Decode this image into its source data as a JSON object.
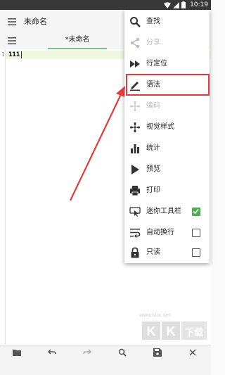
{
  "status_bar": {
    "time": "10:19"
  },
  "app_bar": {
    "title": "未命名"
  },
  "tabs": [
    {
      "label": "*未命名"
    }
  ],
  "editor": {
    "line_numbers": [
      "1"
    ],
    "lines": [
      "111"
    ]
  },
  "menu": {
    "items": [
      {
        "label": "查找",
        "icon": "search-icon",
        "enabled": true
      },
      {
        "label": "分享",
        "icon": "share-icon",
        "enabled": false
      },
      {
        "label": "行定位",
        "icon": "fast-forward-icon",
        "enabled": true
      },
      {
        "label": "语法",
        "icon": "pen-icon",
        "enabled": true
      },
      {
        "label": "编码",
        "icon": "fan-icon",
        "enabled": false
      },
      {
        "label": "视觉样式",
        "icon": "fan-icon",
        "enabled": true
      },
      {
        "label": "统计",
        "icon": "bar-chart-icon",
        "enabled": true
      },
      {
        "label": "预览",
        "icon": "play-icon",
        "enabled": true
      },
      {
        "label": "打印",
        "icon": "printer-icon",
        "enabled": true
      },
      {
        "label": "迷你工具栏",
        "icon": "touch-icon",
        "enabled": true,
        "checked": true
      },
      {
        "label": "自动换行",
        "icon": "wrap-icon",
        "enabled": true,
        "checked": false
      },
      {
        "label": "只读",
        "icon": "lock-icon",
        "enabled": true,
        "checked": false
      }
    ]
  },
  "bottom_bar": {
    "icons": [
      "folder-icon",
      "undo-icon",
      "redo-icon",
      "search-icon",
      "save-icon",
      "close-icon"
    ]
  },
  "watermark": {
    "url": "www.kkx.net",
    "logo_text": "KK下载"
  },
  "colors": {
    "accent": "#4caf50",
    "tab_indicator": "#7cc47f",
    "annotation": "#e23b3b"
  }
}
